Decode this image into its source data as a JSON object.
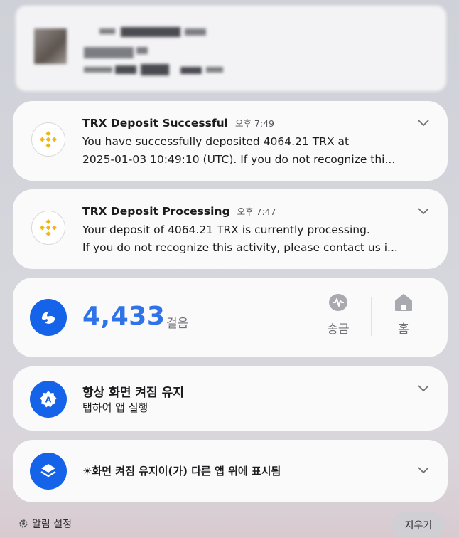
{
  "notifications": [
    {
      "title": "TRX Deposit Successful",
      "time": "오후 7:49",
      "line1": "You have successfully deposited 4064.21 TRX at",
      "line2": "2025-01-03 10:49:10 (UTC). If you do not recognize thi..."
    },
    {
      "title": "TRX Deposit Processing",
      "time": "오후 7:47",
      "line1": "Your deposit of 4064.21 TRX is currently processing.",
      "line2": "If you do not recognize this activity, please contact us i..."
    }
  ],
  "steps": {
    "count": "4,433",
    "unit": "걸음",
    "action_send": "송금",
    "action_home": "홈"
  },
  "keep_screen": {
    "title": "항상 화면 켜짐 유지",
    "subtitle": "탭하여 앱 실행"
  },
  "overlay": {
    "title": "☀화면 켜짐 유지이(가) 다른 앱 위에 표시됨"
  },
  "footer": {
    "settings_label": "알림 설정",
    "clear_label": "지우기"
  },
  "icons": {
    "binance": "binance-logo-icon",
    "steps": "toss-logo-icon",
    "keep_screen": "keep-screen-app-icon",
    "overlay": "layers-icon",
    "send": "send-money-icon",
    "home": "home-icon",
    "settings": "gear-icon",
    "expand": "chevron-down-icon"
  },
  "colors": {
    "accent_blue": "#1463e8",
    "steps_blue": "#2f73e8",
    "binance_yellow": "#f0b90b"
  }
}
